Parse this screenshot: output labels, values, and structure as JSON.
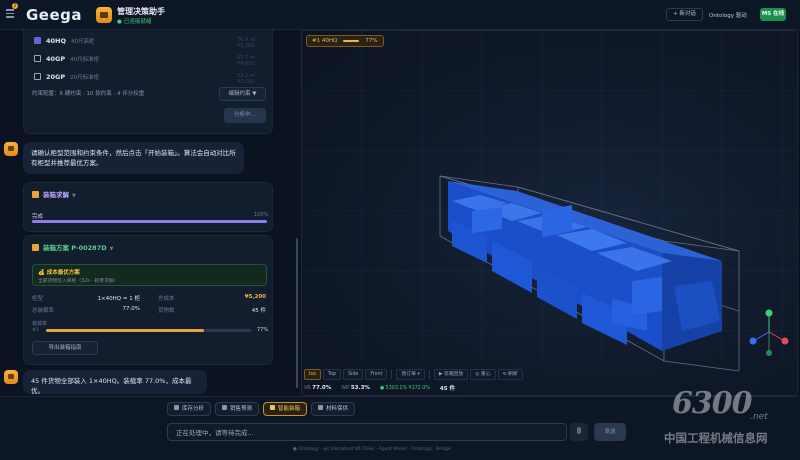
{
  "header": {
    "logo": "Geega",
    "notification_count": "2",
    "app_title": "管理决策助手",
    "app_status": "已连接就绪",
    "new_chat": "+ 新对话",
    "ontology": "Ontology 驱动",
    "ms_badge": "MS 在线"
  },
  "options": [
    {
      "name": "40HQ",
      "desc": "40尺高柜",
      "meta": "76.4 m³ ¥5,200",
      "checked": true
    },
    {
      "name": "40GP",
      "desc": "40尺标准柜",
      "meta": "67.7 m³ ¥4,600",
      "checked": false
    },
    {
      "name": "20GP",
      "desc": "20尺标准柜",
      "meta": "33.2 m³ ¥3,000",
      "checked": false
    }
  ],
  "constraints": {
    "text": "约束配置：6 硬约束 · 10 软约束 · 4 评分权重",
    "edit_button": "编辑约束 ▼",
    "analyze_button": "分析中..."
  },
  "messages": {
    "instruction": "请确认柜型范围和约束条件，然后点击「开始装箱」。算法会自动对比所有柜型并推荐最优方案。",
    "result": "45 件货物全部装入 1×40HQ。装载率 77.0%，成本最优。"
  },
  "solver": {
    "title": "装箱求解",
    "done_label": "完成",
    "done_pct": "100%",
    "progress": 100
  },
  "plan": {
    "title": "装箱方案 P-00287D",
    "best_title": "💰 成本最优方案",
    "best_sub": "全部货物装入单柜（32s · 耗费求解）",
    "stats": [
      {
        "k": "柜型",
        "v": "1×40HQ = 1 柜"
      },
      {
        "k": "总成本",
        "v": "¥5,200"
      },
      {
        "k": "总装载率",
        "v": "77.0%"
      },
      {
        "k": "货物数",
        "v": "45 件"
      }
    ],
    "rate_label": "装载率",
    "rate_item": "#1",
    "rate_value": 77,
    "rate_text": "77%",
    "export_button": "导出装箱指南"
  },
  "viewer": {
    "tag_left": "#1 40HQ",
    "tag_right": "77%",
    "toolbar": [
      "Iso",
      "Top",
      "Side",
      "Front",
      "我订单 ▾",
      "▶ 装箱回放",
      "◎ 重心",
      "⟲ 刷新"
    ],
    "status": [
      {
        "k": "VR",
        "v": "77.0%"
      },
      {
        "k": "WR",
        "v": "53.3%"
      },
      {
        "k": "",
        "v": "● 5303.1% ¥172.0%"
      },
      {
        "k": "",
        "v": "45 件"
      }
    ]
  },
  "bottom": {
    "tabs": [
      {
        "label": "库存分析",
        "active": false
      },
      {
        "label": "销售预测",
        "active": false
      },
      {
        "label": "智能装箱",
        "active": true
      },
      {
        "label": "材料保供",
        "active": false
      }
    ],
    "placeholder": "正在处理中，请等待完成...",
    "send": "发送",
    "footer": "● Ontology · ws://localhost:8173/ws · Agent Model · Ontology · Bridge"
  },
  "watermark": {
    "number": "6300",
    "net": ".net",
    "name": "中国工程机械信息网"
  }
}
